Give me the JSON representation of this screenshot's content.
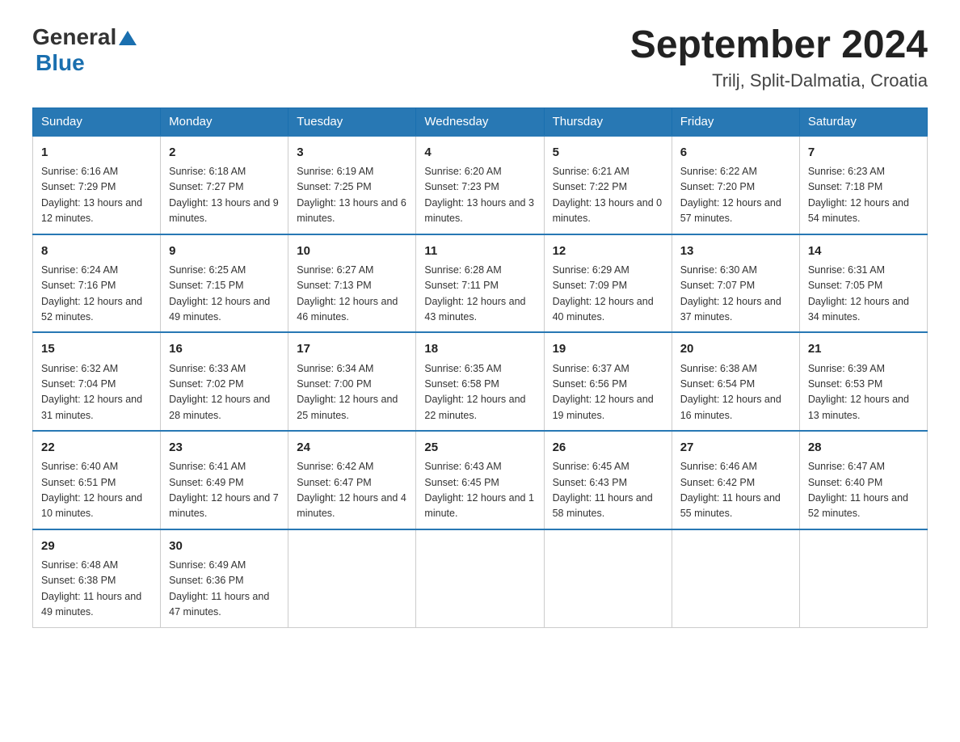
{
  "header": {
    "logo_general": "General",
    "logo_blue": "Blue",
    "title": "September 2024",
    "location": "Trilj, Split-Dalmatia, Croatia"
  },
  "weekdays": [
    "Sunday",
    "Monday",
    "Tuesday",
    "Wednesday",
    "Thursday",
    "Friday",
    "Saturday"
  ],
  "weeks": [
    [
      {
        "day": "1",
        "sunrise": "6:16 AM",
        "sunset": "7:29 PM",
        "daylight": "13 hours and 12 minutes."
      },
      {
        "day": "2",
        "sunrise": "6:18 AM",
        "sunset": "7:27 PM",
        "daylight": "13 hours and 9 minutes."
      },
      {
        "day": "3",
        "sunrise": "6:19 AM",
        "sunset": "7:25 PM",
        "daylight": "13 hours and 6 minutes."
      },
      {
        "day": "4",
        "sunrise": "6:20 AM",
        "sunset": "7:23 PM",
        "daylight": "13 hours and 3 minutes."
      },
      {
        "day": "5",
        "sunrise": "6:21 AM",
        "sunset": "7:22 PM",
        "daylight": "13 hours and 0 minutes."
      },
      {
        "day": "6",
        "sunrise": "6:22 AM",
        "sunset": "7:20 PM",
        "daylight": "12 hours and 57 minutes."
      },
      {
        "day": "7",
        "sunrise": "6:23 AM",
        "sunset": "7:18 PM",
        "daylight": "12 hours and 54 minutes."
      }
    ],
    [
      {
        "day": "8",
        "sunrise": "6:24 AM",
        "sunset": "7:16 PM",
        "daylight": "12 hours and 52 minutes."
      },
      {
        "day": "9",
        "sunrise": "6:25 AM",
        "sunset": "7:15 PM",
        "daylight": "12 hours and 49 minutes."
      },
      {
        "day": "10",
        "sunrise": "6:27 AM",
        "sunset": "7:13 PM",
        "daylight": "12 hours and 46 minutes."
      },
      {
        "day": "11",
        "sunrise": "6:28 AM",
        "sunset": "7:11 PM",
        "daylight": "12 hours and 43 minutes."
      },
      {
        "day": "12",
        "sunrise": "6:29 AM",
        "sunset": "7:09 PM",
        "daylight": "12 hours and 40 minutes."
      },
      {
        "day": "13",
        "sunrise": "6:30 AM",
        "sunset": "7:07 PM",
        "daylight": "12 hours and 37 minutes."
      },
      {
        "day": "14",
        "sunrise": "6:31 AM",
        "sunset": "7:05 PM",
        "daylight": "12 hours and 34 minutes."
      }
    ],
    [
      {
        "day": "15",
        "sunrise": "6:32 AM",
        "sunset": "7:04 PM",
        "daylight": "12 hours and 31 minutes."
      },
      {
        "day": "16",
        "sunrise": "6:33 AM",
        "sunset": "7:02 PM",
        "daylight": "12 hours and 28 minutes."
      },
      {
        "day": "17",
        "sunrise": "6:34 AM",
        "sunset": "7:00 PM",
        "daylight": "12 hours and 25 minutes."
      },
      {
        "day": "18",
        "sunrise": "6:35 AM",
        "sunset": "6:58 PM",
        "daylight": "12 hours and 22 minutes."
      },
      {
        "day": "19",
        "sunrise": "6:37 AM",
        "sunset": "6:56 PM",
        "daylight": "12 hours and 19 minutes."
      },
      {
        "day": "20",
        "sunrise": "6:38 AM",
        "sunset": "6:54 PM",
        "daylight": "12 hours and 16 minutes."
      },
      {
        "day": "21",
        "sunrise": "6:39 AM",
        "sunset": "6:53 PM",
        "daylight": "12 hours and 13 minutes."
      }
    ],
    [
      {
        "day": "22",
        "sunrise": "6:40 AM",
        "sunset": "6:51 PM",
        "daylight": "12 hours and 10 minutes."
      },
      {
        "day": "23",
        "sunrise": "6:41 AM",
        "sunset": "6:49 PM",
        "daylight": "12 hours and 7 minutes."
      },
      {
        "day": "24",
        "sunrise": "6:42 AM",
        "sunset": "6:47 PM",
        "daylight": "12 hours and 4 minutes."
      },
      {
        "day": "25",
        "sunrise": "6:43 AM",
        "sunset": "6:45 PM",
        "daylight": "12 hours and 1 minute."
      },
      {
        "day": "26",
        "sunrise": "6:45 AM",
        "sunset": "6:43 PM",
        "daylight": "11 hours and 58 minutes."
      },
      {
        "day": "27",
        "sunrise": "6:46 AM",
        "sunset": "6:42 PM",
        "daylight": "11 hours and 55 minutes."
      },
      {
        "day": "28",
        "sunrise": "6:47 AM",
        "sunset": "6:40 PM",
        "daylight": "11 hours and 52 minutes."
      }
    ],
    [
      {
        "day": "29",
        "sunrise": "6:48 AM",
        "sunset": "6:38 PM",
        "daylight": "11 hours and 49 minutes."
      },
      {
        "day": "30",
        "sunrise": "6:49 AM",
        "sunset": "6:36 PM",
        "daylight": "11 hours and 47 minutes."
      },
      null,
      null,
      null,
      null,
      null
    ]
  ]
}
